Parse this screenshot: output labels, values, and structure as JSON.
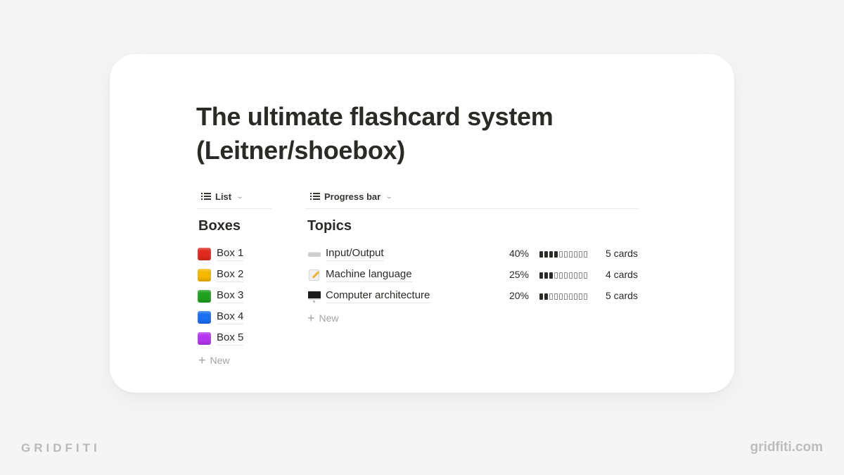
{
  "page": {
    "title_line1": "The ultimate flashcard system",
    "title_line2": "(Leitner/shoebox)"
  },
  "boxes_view": {
    "tab_label": "List",
    "tab_icon": "list-icon",
    "section_title": "Boxes",
    "items": [
      {
        "label": "Box 1",
        "color": "#e02a1f"
      },
      {
        "label": "Box 2",
        "color": "#f6b800"
      },
      {
        "label": "Box 3",
        "color": "#1ea21e"
      },
      {
        "label": "Box 4",
        "color": "#1a6ff2"
      },
      {
        "label": "Box 5",
        "color": "#b536f0"
      }
    ],
    "new_label": "New"
  },
  "topics_view": {
    "tab_label": "Progress bar",
    "tab_icon": "list-icon",
    "section_title": "Topics",
    "items": [
      {
        "label": "Input/Output",
        "icon": "keyboard-icon",
        "percent_label": "40%",
        "progress": 0.4,
        "cards": "5 cards"
      },
      {
        "label": "Machine language",
        "icon": "memo-icon",
        "percent_label": "25%",
        "progress": 0.25,
        "cards": "4 cards"
      },
      {
        "label": "Computer architecture",
        "icon": "desktop-computer-icon",
        "percent_label": "20%",
        "progress": 0.2,
        "cards": "5 cards"
      }
    ],
    "new_label": "New"
  },
  "branding": {
    "left": "GRIDFITI",
    "right": "gridfiti.com"
  }
}
